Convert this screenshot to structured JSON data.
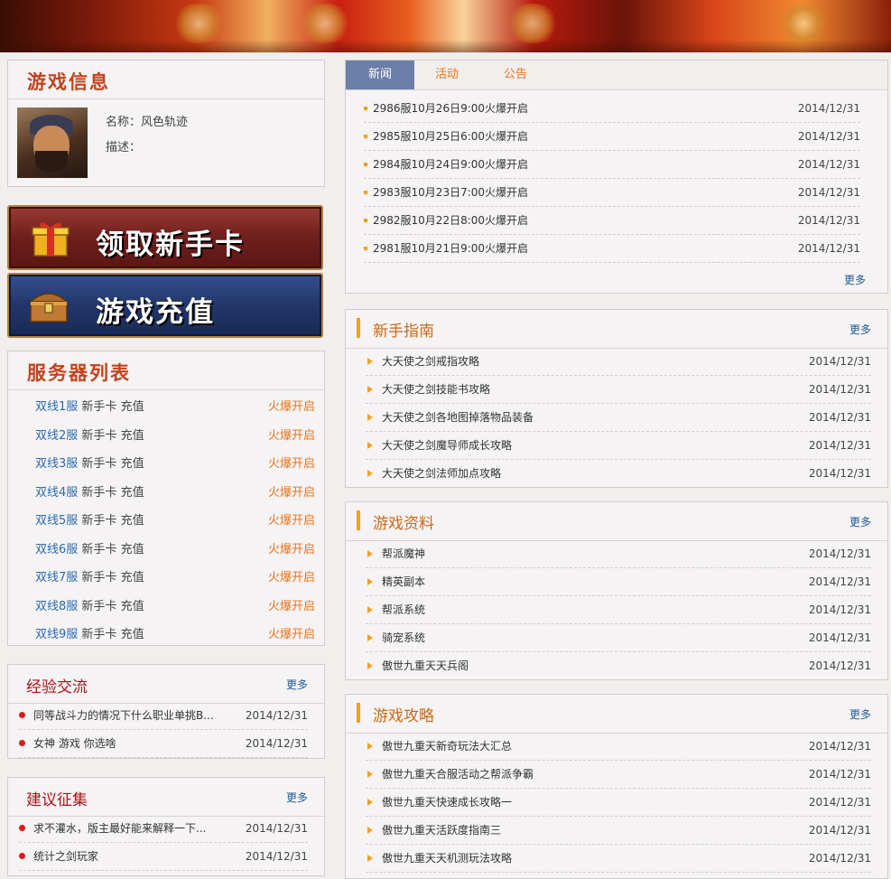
{
  "game_info": {
    "title": "游戏信息",
    "name_label": "名称：风色轨迹",
    "desc_label": "描述："
  },
  "buttons": {
    "newbie_card": "领取新手卡",
    "recharge": "游戏充值"
  },
  "server_list": {
    "title": "服务器列表",
    "card_label": "新手卡",
    "pay_label": "充值",
    "items": [
      {
        "name": "双线1服",
        "status": "火爆开启"
      },
      {
        "name": "双线2服",
        "status": "火爆开启"
      },
      {
        "name": "双线3服",
        "status": "火爆开启"
      },
      {
        "name": "双线4服",
        "status": "火爆开启"
      },
      {
        "name": "双线5服",
        "status": "火爆开启"
      },
      {
        "name": "双线6服",
        "status": "火爆开启"
      },
      {
        "name": "双线7服",
        "status": "火爆开启"
      },
      {
        "name": "双线8服",
        "status": "火爆开启"
      },
      {
        "name": "双线9服",
        "status": "火爆开启"
      }
    ]
  },
  "experience": {
    "title": "经验交流",
    "more": "更多",
    "items": [
      {
        "title": "同等战斗力的情况下什么职业单挑B...",
        "date": "2014/12/31"
      },
      {
        "title": "女神 游戏 你选啥",
        "date": "2014/12/31"
      }
    ]
  },
  "suggestions": {
    "title": "建议征集",
    "more": "更多",
    "items": [
      {
        "title": "求不灌水，版主最好能来解释一下...",
        "date": "2014/12/31"
      },
      {
        "title": "统计之剑玩家",
        "date": "2014/12/31"
      }
    ]
  },
  "news": {
    "tabs": [
      "新闻",
      "活动",
      "公告"
    ],
    "more": "更多",
    "items": [
      {
        "title": "2986服10月26日9:00火爆开启",
        "date": "2014/12/31"
      },
      {
        "title": "2985服10月25日6:00火爆开启",
        "date": "2014/12/31"
      },
      {
        "title": "2984服10月24日9:00火爆开启",
        "date": "2014/12/31"
      },
      {
        "title": "2983服10月23日7:00火爆开启",
        "date": "2014/12/31"
      },
      {
        "title": "2982服10月22日8:00火爆开启",
        "date": "2014/12/31"
      },
      {
        "title": "2981服10月21日9:00火爆开启",
        "date": "2014/12/31"
      }
    ]
  },
  "guide": {
    "title": "新手指南",
    "more": "更多",
    "items": [
      {
        "title": "大天使之剑戒指攻略",
        "date": "2014/12/31"
      },
      {
        "title": "大天使之剑技能书攻略",
        "date": "2014/12/31"
      },
      {
        "title": "大天使之剑各地图掉落物品装备",
        "date": "2014/12/31"
      },
      {
        "title": "大天使之剑魔导师成长攻略",
        "date": "2014/12/31"
      },
      {
        "title": "大天使之剑法师加点攻略",
        "date": "2014/12/31"
      }
    ]
  },
  "game_data": {
    "title": "游戏资料",
    "more": "更多",
    "items": [
      {
        "title": "帮派魔神",
        "date": "2014/12/31"
      },
      {
        "title": "精英副本",
        "date": "2014/12/31"
      },
      {
        "title": "帮派系统",
        "date": "2014/12/31"
      },
      {
        "title": "骑宠系统",
        "date": "2014/12/31"
      },
      {
        "title": "傲世九重天天兵阁",
        "date": "2014/12/31"
      }
    ]
  },
  "strategy": {
    "title": "游戏攻略",
    "more": "更多",
    "items": [
      {
        "title": "傲世九重天新奇玩法大汇总",
        "date": "2014/12/31"
      },
      {
        "title": "傲世九重天合服活动之帮派争霸",
        "date": "2014/12/31"
      },
      {
        "title": "傲世九重天快速成长攻略一",
        "date": "2014/12/31"
      },
      {
        "title": "傲世九重天活跃度指南三",
        "date": "2014/12/31"
      },
      {
        "title": "傲世九重天天机测玩法攻略",
        "date": "2014/12/31"
      }
    ]
  }
}
